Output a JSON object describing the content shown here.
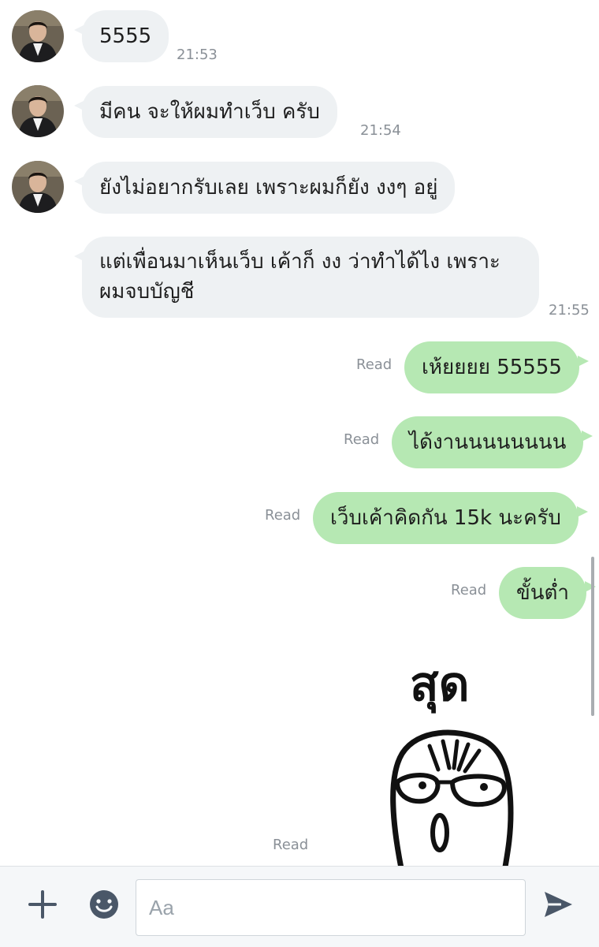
{
  "messages_in": [
    {
      "text": "5555",
      "time": "21:53"
    },
    {
      "text": "มีคน จะให้ผมทำเว็บ ครับ",
      "time": "21:54"
    },
    {
      "text": "ยังไม่อยากรับเลย เพราะผมก็ยัง งงๆ อยู่",
      "time": ""
    },
    {
      "text_line1": "แต่เพื่อนมาเห็นเว็บ เค้าก็ งง ว่าทำได้ไง เพราะ",
      "text_line2": "ผมจบบัญชี",
      "time": "21:55"
    }
  ],
  "messages_out": [
    {
      "text": "เห้ยยยย 55555",
      "status": "Read"
    },
    {
      "text": "ได้งานนนนนนนน",
      "status": "Read"
    },
    {
      "text": "เว็บเค้าคิดกัน 15k นะครับ",
      "status": "Read"
    },
    {
      "text": "ขั้นต่ำ",
      "status": "Read"
    }
  ],
  "sticker": {
    "status": "Read",
    "caption": "สุด"
  },
  "composer": {
    "placeholder": "Aa",
    "icons": [
      "plus-icon",
      "emoji-icon",
      "send-icon"
    ]
  },
  "colors": {
    "incoming_bubble": "#eef1f3",
    "outgoing_bubble": "#b6e8b3",
    "meta_text": "#8a9097"
  }
}
